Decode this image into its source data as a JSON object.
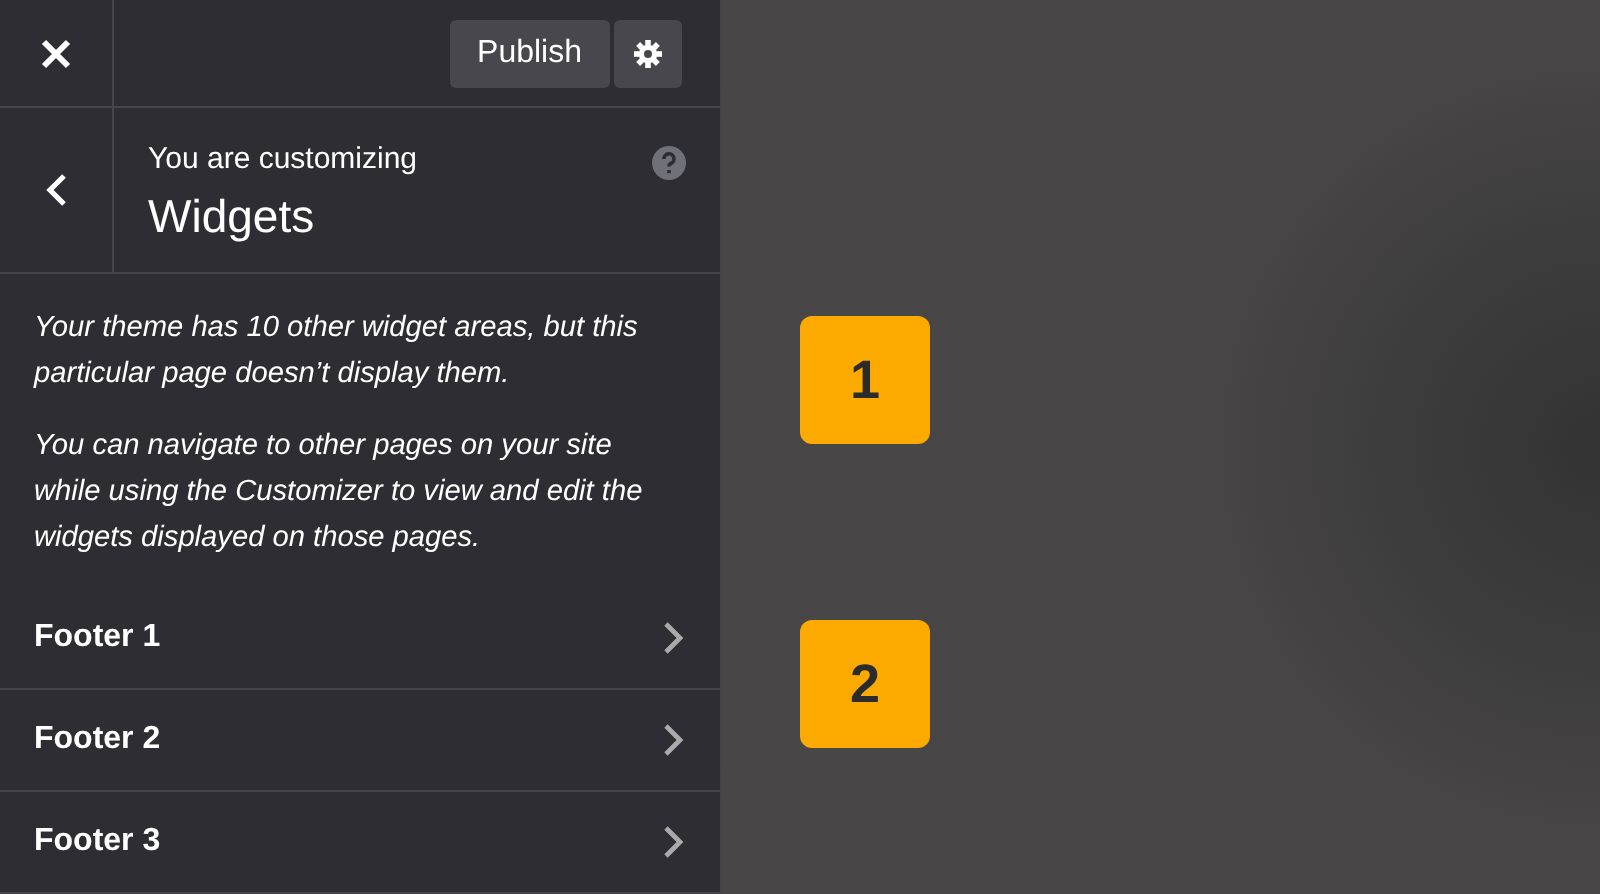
{
  "header": {
    "publish_button": "Publish"
  },
  "section": {
    "eyebrow": "You are customizing",
    "title": "Widgets"
  },
  "notices": [
    "Your theme has 10 other widget areas, but this particular page doesn’t display them.",
    "You can navigate to other pages on your site while using the Customizer to view and edit the widgets displayed on those pages."
  ],
  "areas": [
    {
      "label": "Footer 1"
    },
    {
      "label": "Footer 2"
    },
    {
      "label": "Footer 3"
    }
  ],
  "markers": [
    "1",
    "2"
  ]
}
